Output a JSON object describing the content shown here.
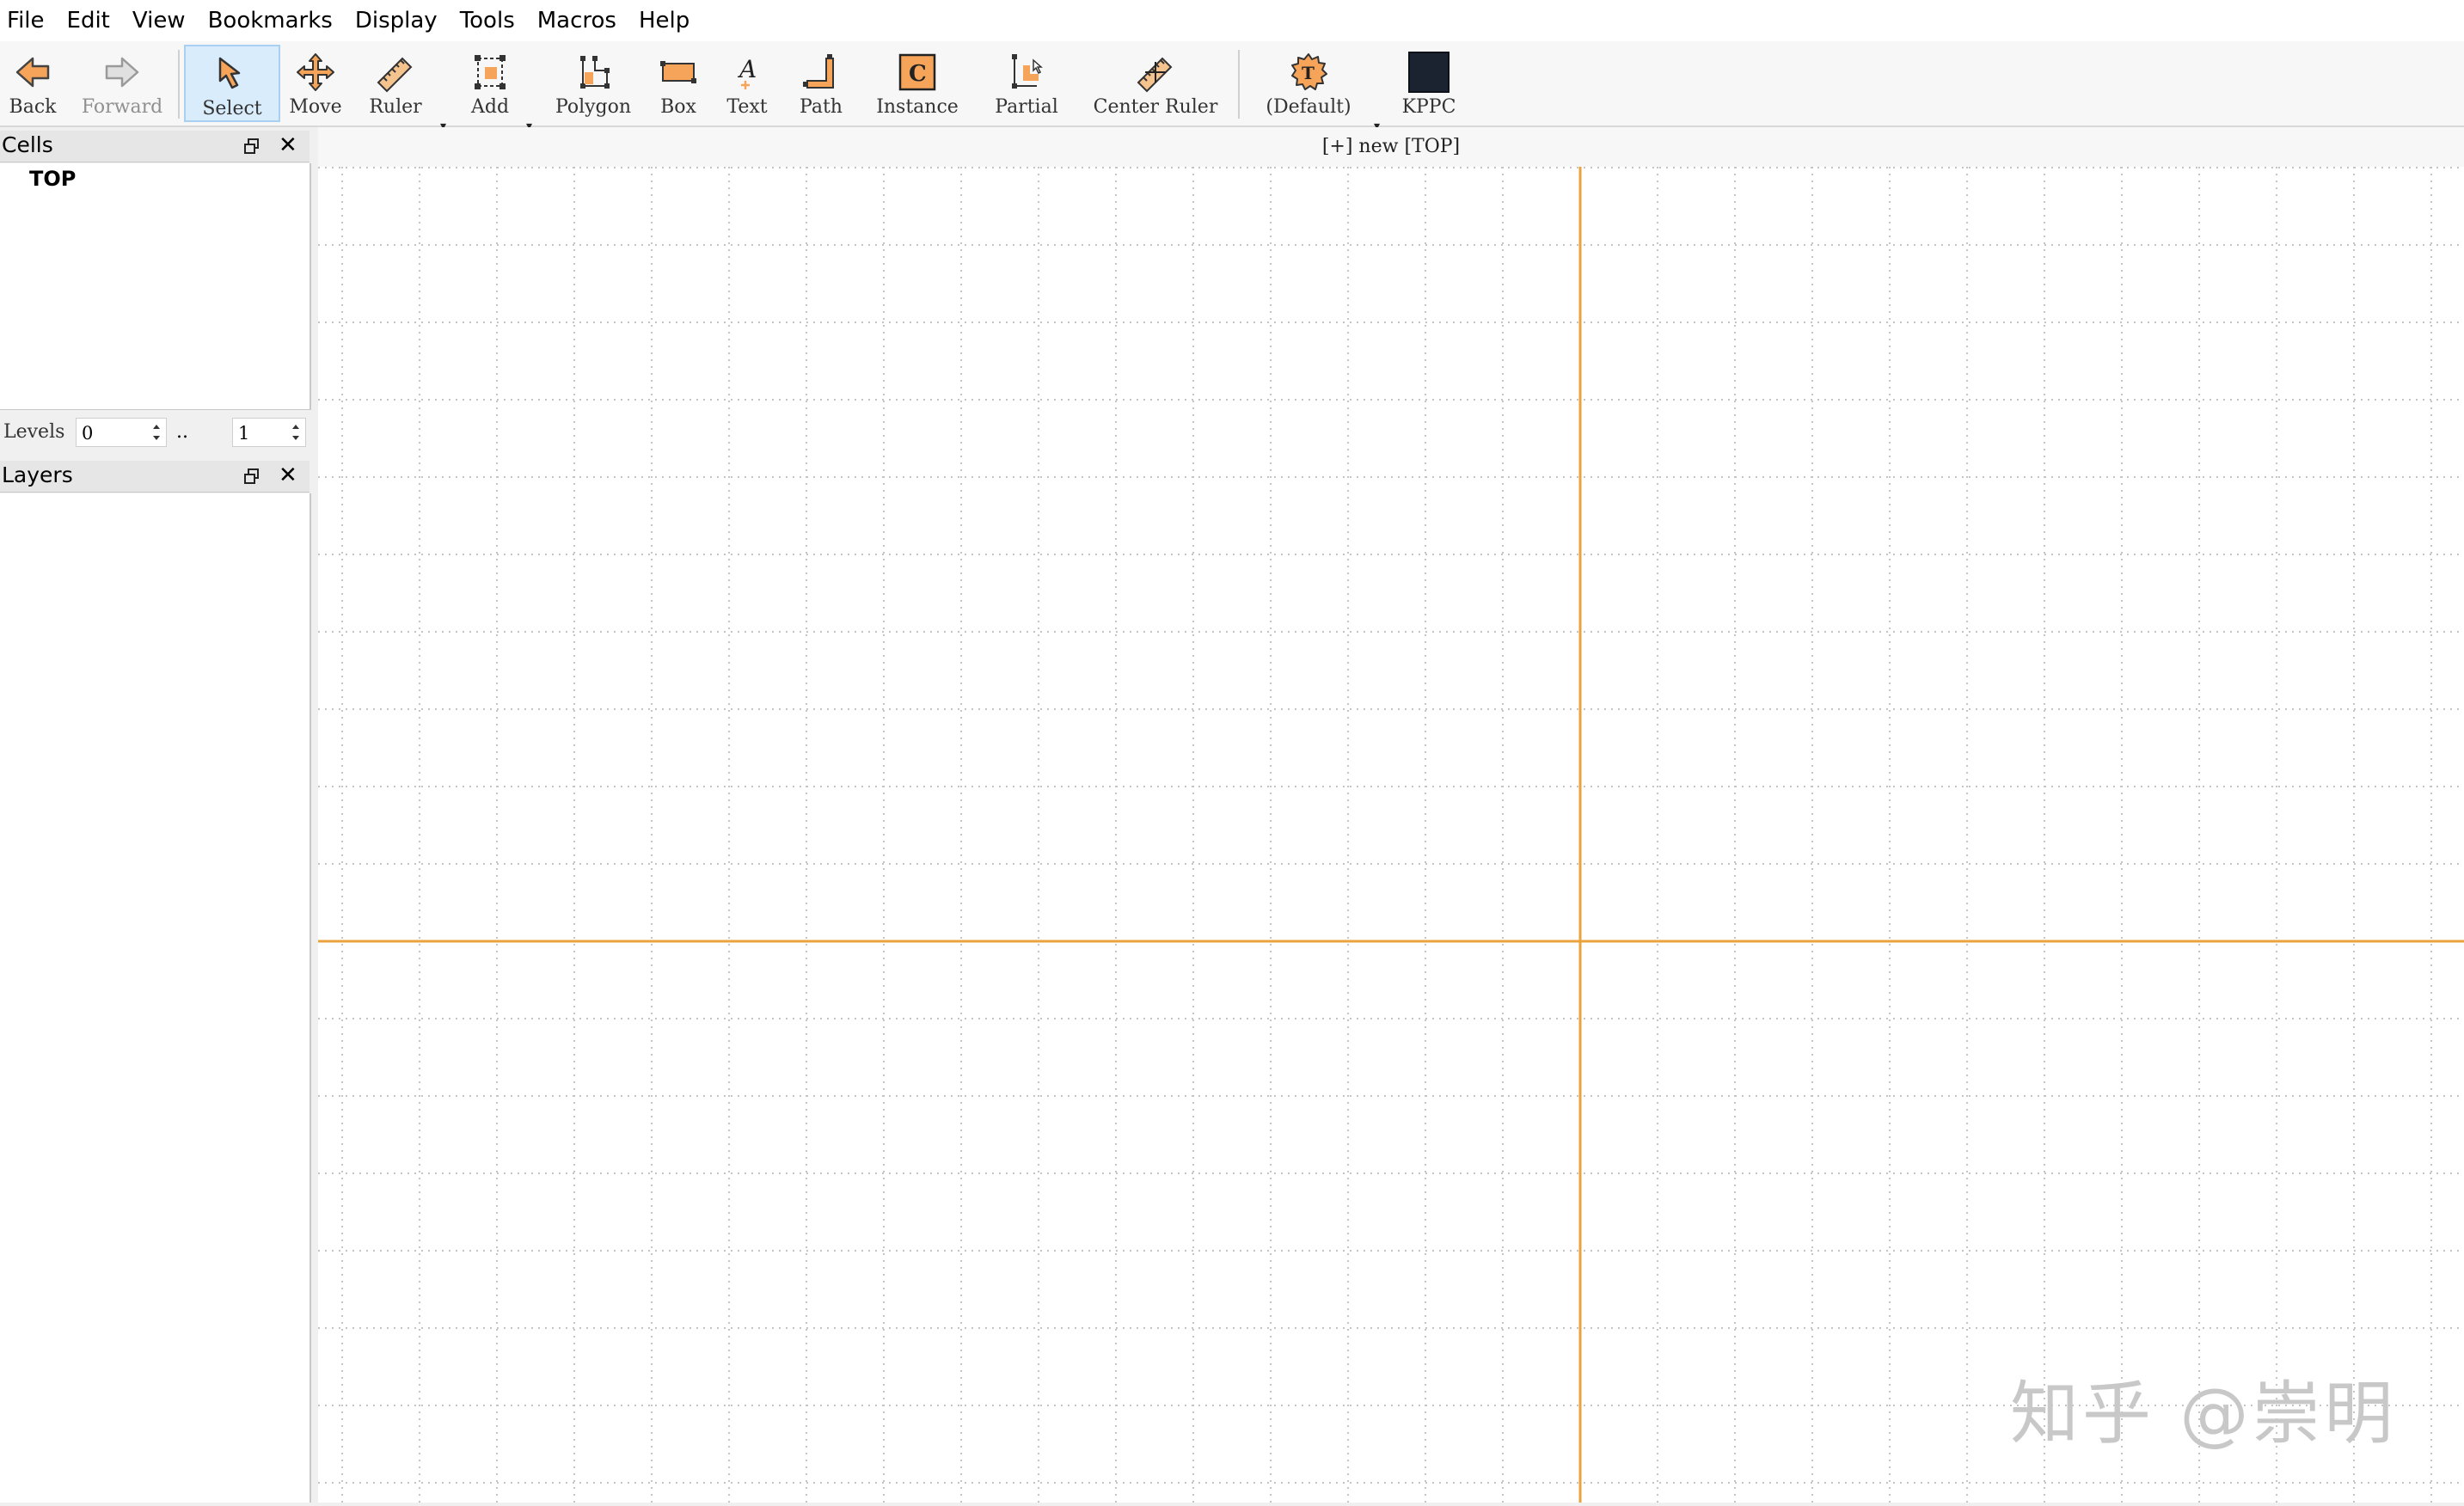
{
  "menu": [
    "File",
    "Edit",
    "View",
    "Bookmarks",
    "Display",
    "Tools",
    "Macros",
    "Help"
  ],
  "toolbar": {
    "back": "Back",
    "forward": "Forward",
    "select": "Select",
    "move": "Move",
    "ruler": "Ruler",
    "add": "Add",
    "polygon": "Polygon",
    "box": "Box",
    "text": "Text",
    "path": "Path",
    "instance": "Instance",
    "partial": "Partial",
    "center_ruler": "Center Ruler",
    "default": "(Default)",
    "kppc": "KPPC",
    "active_tool": "Select"
  },
  "cells_panel": {
    "title": "Cells",
    "items": [
      "TOP"
    ],
    "levels_label": "Levels",
    "levels_min": "0",
    "levels_sep": "..",
    "levels_max": "1"
  },
  "layers_panel": {
    "title": "Layers"
  },
  "canvas": {
    "tab_label": "[+] new [TOP]"
  },
  "colors": {
    "axis": "#e8a33d",
    "grid": "#c4c4c4",
    "accent_icon": "#f5a45a",
    "kppc_swatch": "#1b2230"
  },
  "watermark": "知乎 @崇明"
}
